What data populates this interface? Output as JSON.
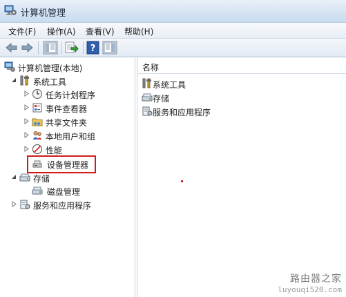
{
  "window": {
    "title": "计算机管理"
  },
  "menu": [
    "文件(F)",
    "操作(A)",
    "查看(V)",
    "帮助(H)"
  ],
  "toolbar": {
    "buttons": [
      "back-icon",
      "forward-icon",
      "show-hide-console-tree-icon",
      "export-list-icon",
      "help-icon",
      "show-hide-action-pane-icon"
    ]
  },
  "tree": {
    "root": "计算机管理(本地)",
    "system_tools": {
      "label": "系统工具",
      "children": [
        "任务计划程序",
        "事件查看器",
        "共享文件夹",
        "本地用户和组",
        "性能",
        "设备管理器"
      ]
    },
    "storage": {
      "label": "存储",
      "children": [
        "磁盘管理"
      ]
    },
    "services": {
      "label": "服务和应用程序"
    }
  },
  "right": {
    "column_header": "名称",
    "items": [
      "系统工具",
      "存储",
      "服务和应用程序"
    ]
  },
  "highlight": {
    "color": "#d01b1b",
    "target": "设备管理器"
  },
  "watermark": {
    "line1": "路由器之家",
    "line2": "luyouqi520.com"
  }
}
